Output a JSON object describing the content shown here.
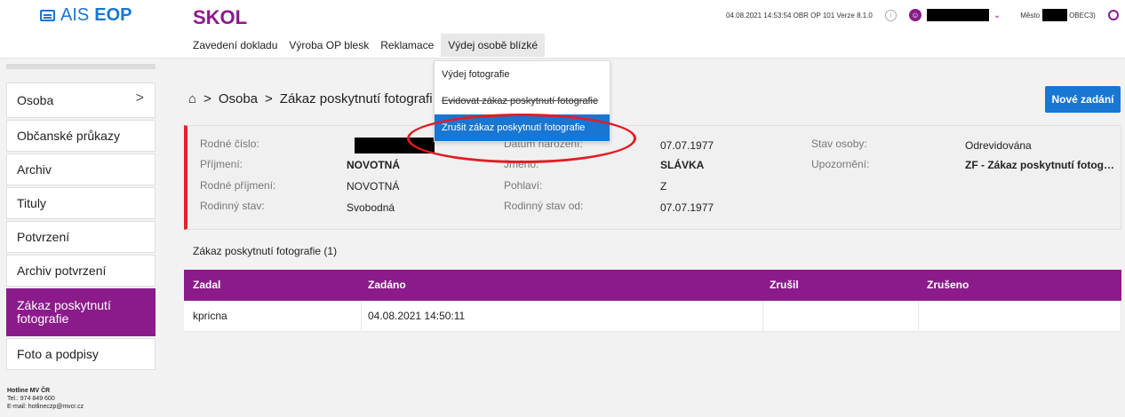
{
  "header": {
    "logo_text_1": "AIS",
    "logo_text_2": "EOP",
    "app_title": "SKOL",
    "version": "04.08.2021 14:53:54 OBR OP 101 Verze 8.1.0",
    "mesto_label": "Město",
    "mesto_value": "OBEC3)"
  },
  "nav": {
    "items": [
      "Zavedení dokladu",
      "Výroba OP blesk",
      "Reklamace",
      "Výdej osobě blízké"
    ]
  },
  "dropdown": {
    "items": [
      "Výdej fotografie",
      "Evidovat zákaz poskytnutí fotografie",
      "Zrušit zákaz poskytnutí fotografie"
    ]
  },
  "sidebar": {
    "items": [
      "Osoba",
      "Občanské průkazy",
      "Archiv",
      "Tituly",
      "Potvrzení",
      "Archiv potvrzení",
      "Zákaz poskytnutí fotografie",
      "Foto a podpisy"
    ],
    "active": "Zákaz poskytnutí fotografie"
  },
  "hotline": {
    "title": "Hotline MV ČR",
    "tel": "Tel.: 974 849 600",
    "email": "E-mail: hotlineczp@mvcr.cz"
  },
  "breadcrumb": {
    "level1": "Osoba",
    "level2": "Zákaz poskytnutí fotografi"
  },
  "buttons": {
    "new": "Nové zadání"
  },
  "person": {
    "rodne_cislo_label": "Rodné číslo:",
    "datum_narozeni_label": "Datum narození:",
    "datum_narozeni": "07.07.1977",
    "stav_osoby_label": "Stav osoby:",
    "stav_osoby": "Odrevidována",
    "prijmeni_label": "Příjmení:",
    "prijmeni": "NOVOTNÁ",
    "jmeno_label": "Jméno:",
    "jmeno": "SLÁVKA",
    "upozorneni_label": "Upozornění:",
    "upozorneni": "ZF - Zákaz poskytnutí fotog…",
    "rodne_prijmeni_label": "Rodné příjmení:",
    "rodne_prijmeni": "NOVOTNÁ",
    "pohlavi_label": "Pohlaví:",
    "pohlavi": "Z",
    "rodinny_stav_label": "Rodinný stav:",
    "rodinny_stav": "Svobodná",
    "rodinny_stav_od_label": "Rodinný stav od:",
    "rodinny_stav_od": "07.07.1977"
  },
  "section": {
    "title": "Zákaz poskytnutí fotografie (1)"
  },
  "table": {
    "columns": [
      "Zadal",
      "Zadáno",
      "Zrušil",
      "Zrušeno"
    ],
    "rows": [
      [
        "kpricna",
        "04.08.2021 14:50:11",
        "",
        ""
      ]
    ]
  },
  "colors": {
    "brand": "#8b1b8b",
    "accent": "#1976d2",
    "alert": "#e0242b"
  },
  "icons": [
    "card-icon",
    "info-icon",
    "user-icon",
    "chevron-down-icon",
    "logout-icon",
    "chevron-right-icon",
    "home-icon"
  ]
}
